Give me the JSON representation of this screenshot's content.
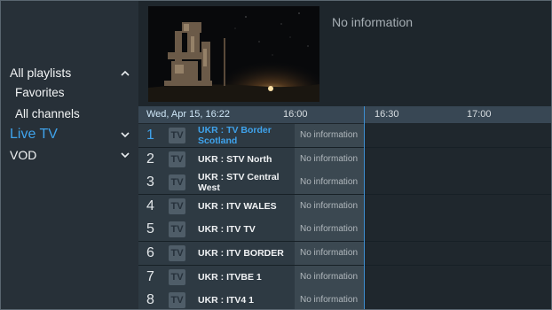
{
  "sidebar": {
    "items": [
      {
        "label": "All playlists",
        "chevron": "up"
      },
      {
        "label": "Favorites"
      },
      {
        "label": "All channels"
      },
      {
        "label": "Live TV",
        "chevron": "down",
        "active": true
      },
      {
        "label": "VOD",
        "chevron": "down"
      }
    ]
  },
  "preview": {
    "info": "No information"
  },
  "timeline": {
    "date": "Wed, Apr 15, 16:22",
    "times": [
      "16:00",
      "16:30",
      "17:00"
    ]
  },
  "channels": [
    {
      "num": "1",
      "name": "UKR : TV Border Scotland",
      "program": "No information",
      "icon": "TV",
      "selected": true
    },
    {
      "num": "2",
      "name": "UKR : STV North",
      "program": "No information",
      "icon": "TV"
    },
    {
      "num": "3",
      "name": "UKR : STV Central West",
      "program": "No information",
      "icon": "TV"
    },
    {
      "num": "4",
      "name": "UKR : ITV WALES",
      "program": "No information",
      "icon": "TV"
    },
    {
      "num": "5",
      "name": "UKR : ITV TV",
      "program": "No information",
      "icon": "TV"
    },
    {
      "num": "6",
      "name": "UKR : ITV BORDER",
      "program": "No information",
      "icon": "TV"
    },
    {
      "num": "7",
      "name": "UKR : ITVBE  1",
      "program": "No information",
      "icon": "TV"
    },
    {
      "num": "8",
      "name": "UKR : ITV4 1",
      "program": "No information",
      "icon": "TV"
    }
  ],
  "colors": {
    "accent": "#3fa3ec",
    "sidebar": "#273038",
    "timeline": "#384754"
  }
}
